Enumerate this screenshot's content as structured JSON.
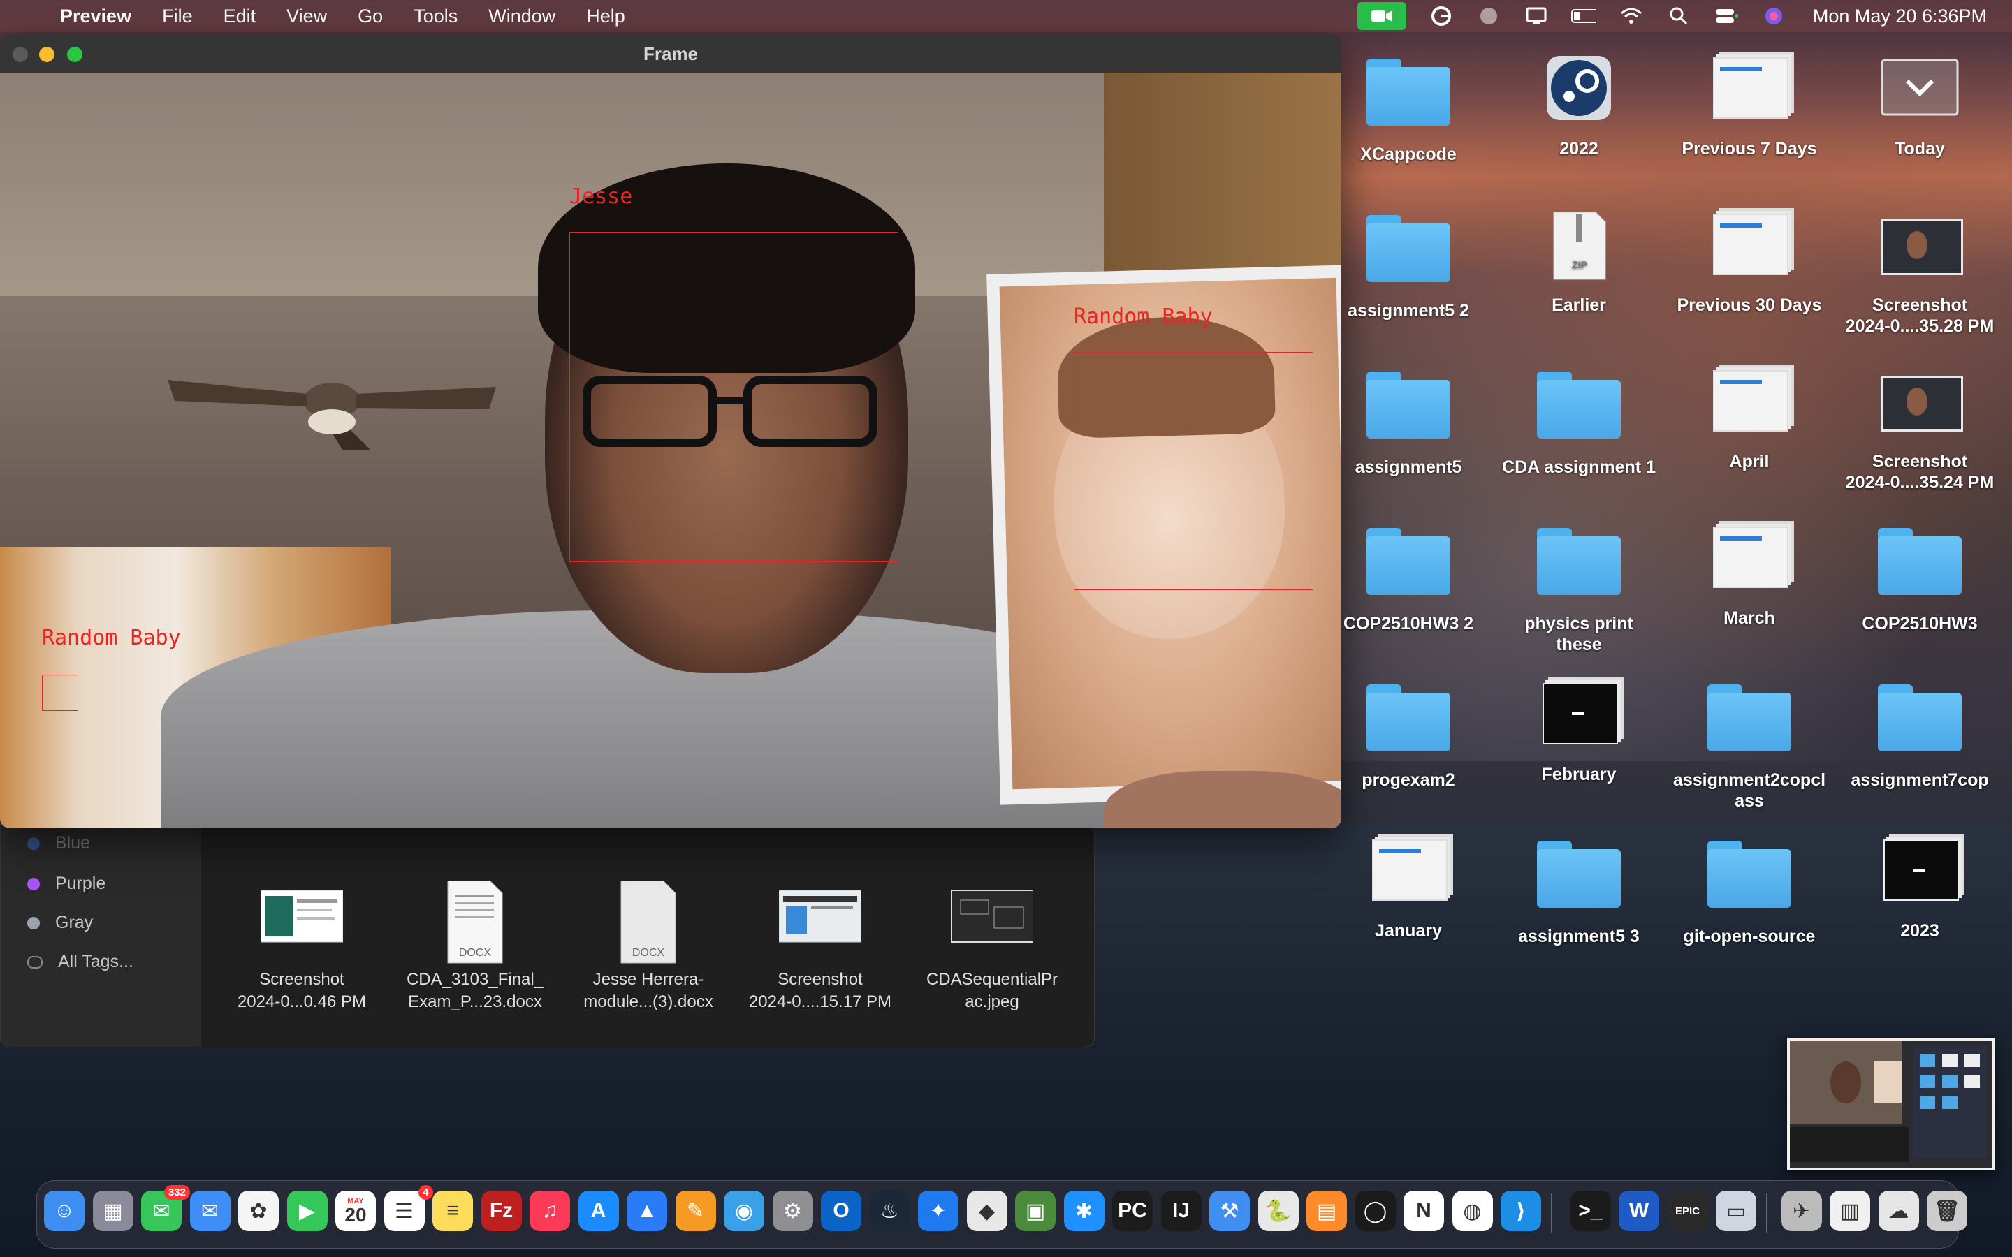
{
  "menubar": {
    "apple": "",
    "app_name": "Preview",
    "menus": [
      "File",
      "Edit",
      "View",
      "Go",
      "Tools",
      "Window",
      "Help"
    ],
    "clock": "Mon May 20  6:36PM"
  },
  "window": {
    "title": "Frame",
    "detections": [
      {
        "label": "Jesse"
      },
      {
        "label": "Random Baby"
      },
      {
        "label": "Random Baby"
      }
    ]
  },
  "finder": {
    "tags": [
      {
        "label": "Blue",
        "color": "#3b82f6"
      },
      {
        "label": "Purple",
        "color": "#a855f7"
      },
      {
        "label": "Gray",
        "color": "#9ca3af"
      },
      {
        "label": "All Tags..."
      }
    ],
    "files": [
      {
        "line1": "Screenshot",
        "line2": "2024-0...0.46 PM"
      },
      {
        "line1": "CDA_3103_Final_",
        "line2": "Exam_P...23.docx",
        "badge": "DOCX"
      },
      {
        "line1": "Jesse Herrera-",
        "line2": "module...(3).docx",
        "badge": "DOCX"
      },
      {
        "line1": "Screenshot",
        "line2": "2024-0....15.17 PM"
      },
      {
        "line1": "CDASequentialPr",
        "line2": "ac.jpeg"
      }
    ]
  },
  "desktop": {
    "icons": [
      {
        "label": "XCappcode",
        "kind": "folder"
      },
      {
        "label": "2022",
        "kind": "steam"
      },
      {
        "label": "Previous 7 Days",
        "kind": "stack"
      },
      {
        "label": "Today",
        "kind": "stack-empty"
      },
      {
        "label": "assignment5 2",
        "kind": "folder"
      },
      {
        "label": "Earlier",
        "kind": "zip",
        "badge": "ZIP"
      },
      {
        "label": "Previous 30 Days",
        "kind": "stack"
      },
      {
        "label": "Screenshot\n2024-0....35.28 PM",
        "kind": "shot"
      },
      {
        "label": "assignment5",
        "kind": "folder"
      },
      {
        "label": "CDA assignment 1",
        "kind": "folder"
      },
      {
        "label": "April",
        "kind": "stack"
      },
      {
        "label": "Screenshot\n2024-0....35.24 PM",
        "kind": "shot"
      },
      {
        "label": "COP2510HW3 2",
        "kind": "folder"
      },
      {
        "label": "physics print\nthese",
        "kind": "folder"
      },
      {
        "label": "March",
        "kind": "stack"
      },
      {
        "label": "COP2510HW3",
        "kind": "folder"
      },
      {
        "label": "progexam2",
        "kind": "folder"
      },
      {
        "label": "February",
        "kind": "stack-dark"
      },
      {
        "label": "assignment2copcl\nass",
        "kind": "folder"
      },
      {
        "label": "assignment7cop",
        "kind": "folder"
      },
      {
        "label": "January",
        "kind": "stack"
      },
      {
        "label": "assignment5 3",
        "kind": "folder"
      },
      {
        "label": "git-open-source",
        "kind": "folder"
      },
      {
        "label": "2023",
        "kind": "stack-dark"
      }
    ]
  },
  "dock": {
    "apps": [
      {
        "name": "finder",
        "color": "#3d8ef0",
        "glyph": "☺"
      },
      {
        "name": "launchpad",
        "color": "#8a8a9a",
        "glyph": "▦"
      },
      {
        "name": "messages",
        "color": "#35c759",
        "glyph": "✉",
        "badge": "332"
      },
      {
        "name": "mail",
        "color": "#3e8ef7",
        "glyph": "✉"
      },
      {
        "name": "photos",
        "color": "#f5f5f5",
        "glyph": "✿"
      },
      {
        "name": "facetime",
        "color": "#34c759",
        "glyph": "▶"
      },
      {
        "name": "calendar",
        "color": "#ffffff",
        "glyph": "20",
        "sub": "MAY"
      },
      {
        "name": "reminders",
        "color": "#ffffff",
        "glyph": "☰",
        "badge": "4"
      },
      {
        "name": "notes",
        "color": "#fddc5c",
        "glyph": "≡"
      },
      {
        "name": "filezilla",
        "color": "#bf1f1f",
        "glyph": "Fz"
      },
      {
        "name": "music",
        "color": "#fa3a57",
        "glyph": "♫"
      },
      {
        "name": "app-store",
        "color": "#1a8cff",
        "glyph": "A"
      },
      {
        "name": "keynote",
        "color": "#2a7cf6",
        "glyph": "▲"
      },
      {
        "name": "pages",
        "color": "#f59a23",
        "glyph": "✎"
      },
      {
        "name": "network-radar",
        "color": "#3aa0e8",
        "glyph": "◉"
      },
      {
        "name": "system-settings",
        "color": "#8e8e93",
        "glyph": "⚙"
      },
      {
        "name": "outlook",
        "color": "#0a64c8",
        "glyph": "O"
      },
      {
        "name": "steam",
        "color": "#1b2838",
        "glyph": "♨"
      },
      {
        "name": "xcode-helper",
        "color": "#1f7af0",
        "glyph": "✦"
      },
      {
        "name": "roblox",
        "color": "#e8e8e8",
        "glyph": "◆"
      },
      {
        "name": "minecraft",
        "color": "#4b8b3b",
        "glyph": "▣"
      },
      {
        "name": "hex-fiend",
        "color": "#1e90ff",
        "glyph": "✱"
      },
      {
        "name": "pycharm",
        "color": "#1c1c1c",
        "glyph": "PC"
      },
      {
        "name": "intellij",
        "color": "#1c1c1c",
        "glyph": "IJ"
      },
      {
        "name": "xcode",
        "color": "#3f8ef0",
        "glyph": "⚒"
      },
      {
        "name": "python-launcher",
        "color": "#e8e8e8",
        "glyph": "🐍"
      },
      {
        "name": "books",
        "color": "#ff8a2a",
        "glyph": "▤"
      },
      {
        "name": "spinner-app",
        "color": "#1b1b1b",
        "glyph": "◯"
      },
      {
        "name": "notion",
        "color": "#ffffff",
        "glyph": "N"
      },
      {
        "name": "chrome",
        "color": "#ffffff",
        "glyph": "◍"
      },
      {
        "name": "vscode",
        "color": "#1c8ee6",
        "glyph": "⟩"
      },
      {
        "name": "terminal",
        "color": "#1b1b1b",
        "glyph": ">_"
      },
      {
        "name": "word",
        "color": "#1e5bc6",
        "glyph": "W"
      },
      {
        "name": "epic-games",
        "color": "#2a2a2a",
        "glyph": "EPIC"
      },
      {
        "name": "preview",
        "color": "#cfd6e0",
        "glyph": "▭"
      },
      {
        "name": "rocket",
        "color": "#bbbbbb",
        "glyph": "✈"
      },
      {
        "name": "downloads-stack",
        "color": "#f0f0f0",
        "glyph": "▥"
      },
      {
        "name": "archive",
        "color": "#e6e6e6",
        "glyph": "☁"
      },
      {
        "name": "trash",
        "color": "#cccccc",
        "glyph": "🗑"
      }
    ]
  }
}
